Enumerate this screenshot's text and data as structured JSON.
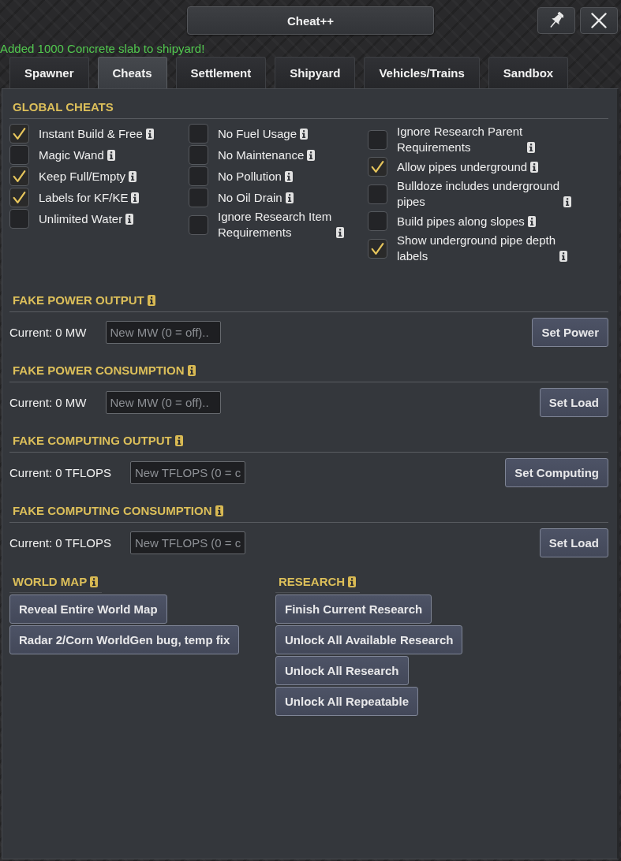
{
  "window": {
    "title": "Cheat++"
  },
  "status_message": "Added 1000 Concrete slab to shipyard!",
  "tabs": [
    {
      "label": "Spawner",
      "selected": false
    },
    {
      "label": "Cheats",
      "selected": true
    },
    {
      "label": "Settlement",
      "selected": false
    },
    {
      "label": "Shipyard",
      "selected": false
    },
    {
      "label": "Vehicles/Trains",
      "selected": false
    },
    {
      "label": "Sandbox",
      "selected": false
    }
  ],
  "global_cheats": {
    "title": "GLOBAL CHEATS",
    "info": false,
    "columns": [
      [
        {
          "label": "Instant Build & Free",
          "checked": true
        },
        {
          "label": "Magic Wand",
          "checked": false
        },
        {
          "label": "Keep Full/Empty",
          "checked": true
        },
        {
          "label": "Labels for KF/KE",
          "checked": true
        },
        {
          "label": "Unlimited Water",
          "checked": false
        }
      ],
      [
        {
          "label": "No Fuel Usage",
          "checked": false
        },
        {
          "label": "No Maintenance",
          "checked": false
        },
        {
          "label": "No Pollution",
          "checked": false
        },
        {
          "label": "No Oil Drain",
          "checked": false
        },
        {
          "label": "Ignore Research Item Requirements",
          "checked": false
        }
      ],
      [
        {
          "label": "Ignore Research Parent Requirements",
          "checked": false
        },
        {
          "label": "Allow pipes underground",
          "checked": true
        },
        {
          "label": "Bulldoze includes underground pipes",
          "checked": false
        },
        {
          "label": "Build pipes along slopes",
          "checked": false
        },
        {
          "label": "Show underground pipe depth labels",
          "checked": true
        }
      ]
    ]
  },
  "value_sections": [
    {
      "title": "FAKE POWER OUTPUT",
      "info": true,
      "current": "Current: 0 MW",
      "placeholder": "New MW (0 = off)..",
      "button": "Set Power"
    },
    {
      "title": "FAKE POWER CONSUMPTION",
      "info": true,
      "current": "Current: 0 MW",
      "placeholder": "New MW (0 = off)..",
      "button": "Set Load"
    },
    {
      "title": "FAKE COMPUTING OUTPUT",
      "info": true,
      "current": "Current: 0 TFLOPS",
      "placeholder": "New TFLOPS (0 = c",
      "button": "Set Computing"
    },
    {
      "title": "FAKE COMPUTING CONSUMPTION",
      "info": true,
      "current": "Current: 0 TFLOPS",
      "placeholder": "New TFLOPS (0 = c",
      "button": "Set Load"
    }
  ],
  "action_groups": [
    {
      "title": "WORLD MAP",
      "info": true,
      "buttons": [
        "Reveal Entire World Map",
        "Radar 2/Corn WorldGen bug, temp fix"
      ]
    },
    {
      "title": "RESEARCH",
      "info": true,
      "buttons": [
        "Finish Current Research",
        "Unlock All Available Research",
        "Unlock All Research",
        "Unlock All Repeatable"
      ]
    }
  ]
}
